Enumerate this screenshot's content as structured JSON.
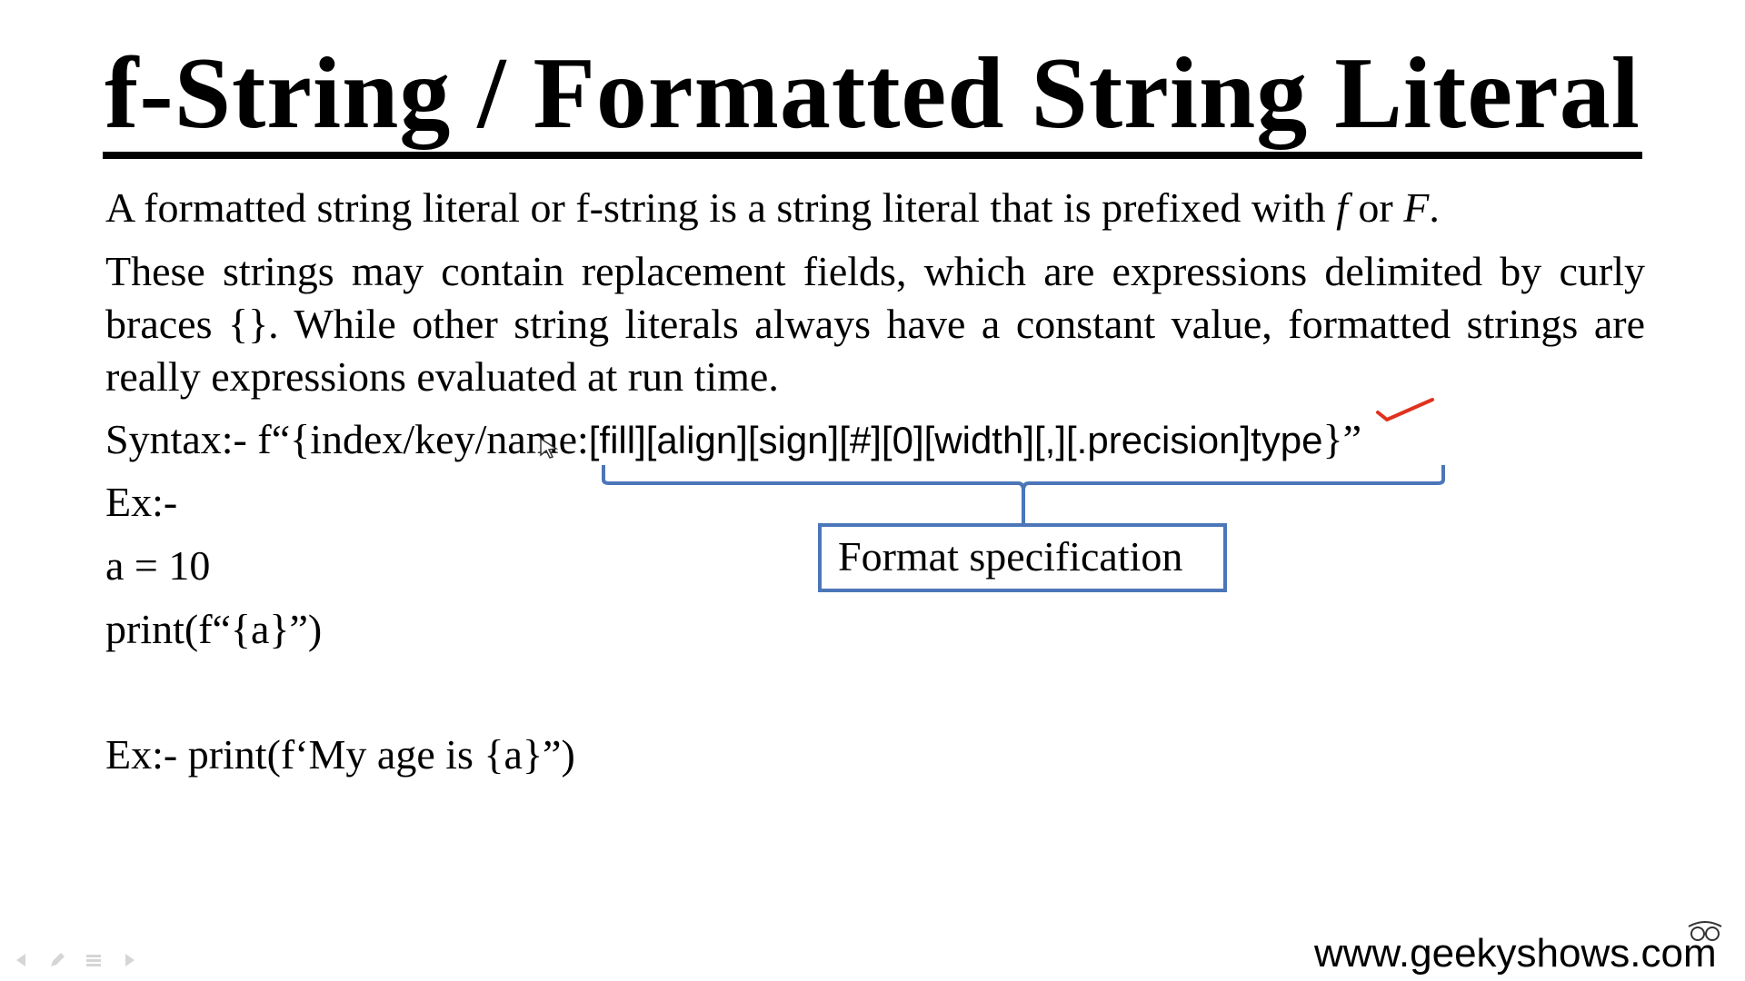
{
  "slide": {
    "title": "f-String / Formatted String Literal",
    "intro_line_start": "A formatted string literal or f-string is a string literal that is prefixed with ",
    "intro_f_lower": "f",
    "intro_or": " or ",
    "intro_f_upper": "F",
    "intro_period": ".",
    "paragraph": "These strings may contain replacement fields, which are expressions delimited by curly braces {}. While other string literals always have a constant value, formatted strings are really expressions evaluated at run time.",
    "syntax_prefix": "Syntax:- f“{index/key/name:",
    "syntax_spec": "[fill][align][sign][#][0][width][,][.precision]type",
    "syntax_suffix": "}”",
    "format_spec_label": "Format specification",
    "example_label": "Ex:-",
    "example_assign": "a = 10",
    "example_print": "print(f“{a}”)",
    "example2": "Ex:- print(f‘My age is {a}”)",
    "website": "www.geekyshows.com"
  },
  "colors": {
    "bracket": "#4b76b8",
    "annotation": "#e0321e",
    "text": "#000000"
  },
  "icons": {
    "check": "red-check-icon",
    "cursor": "pen-cursor-icon",
    "logo": "geekyshows-logo-icon",
    "nav": [
      "arrow-left-icon",
      "pen-icon",
      "menu-icon",
      "arrow-right-icon"
    ]
  }
}
